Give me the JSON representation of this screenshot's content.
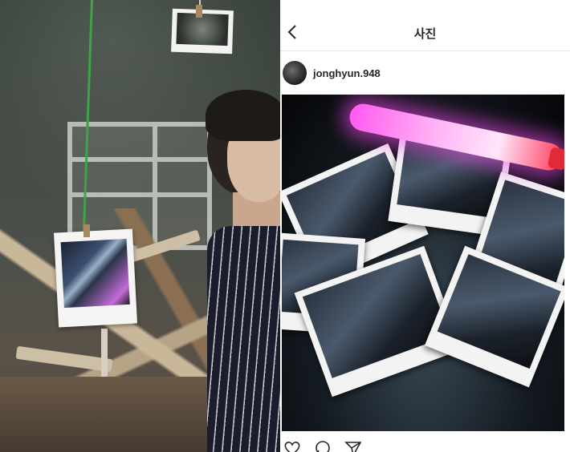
{
  "left_panel": {
    "description_icons": [
      "hanging-photo",
      "polaroid-photo"
    ]
  },
  "instagram": {
    "header": {
      "title": "사진",
      "back_icon": "chevron-left-icon"
    },
    "post": {
      "username": "jonghyun.948",
      "avatar_icon": "profile-avatar",
      "actions": [
        "heart-icon",
        "comment-icon",
        "share-icon"
      ]
    }
  }
}
